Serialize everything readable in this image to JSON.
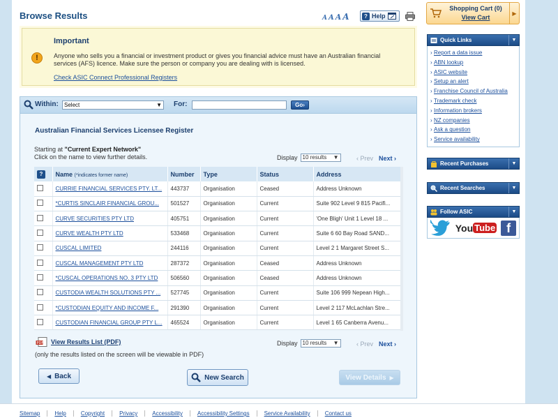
{
  "header": {
    "title": "Browse Results",
    "text_size_letters": [
      "A",
      "A",
      "A",
      "A"
    ],
    "help_label": "Help"
  },
  "important": {
    "heading": "Important",
    "message": "Anyone who sells you a financial or investment product or gives you financial advice must have an Australian financial services (AFS) licence. Make sure the person or company you are dealing with is licensed.",
    "link": "Check ASIC Connect Professional Registers"
  },
  "search": {
    "within_label": "Within:",
    "within_value": "Select",
    "for_label": "For:",
    "for_value": "",
    "go_label": "Go"
  },
  "register": {
    "title": "Australian Financial Services Licensee Register",
    "starting_prefix": "Starting at",
    "starting_value": "\"Current Expert Network\"",
    "instructions": "Click on the name to view further details."
  },
  "pager": {
    "display_label": "Display",
    "display_value": "10 results",
    "prev": "Prev",
    "next": "Next"
  },
  "table": {
    "help_symbol": "?",
    "columns": {
      "name": "Name",
      "name_note": "(*indicates former name)",
      "number": "Number",
      "type": "Type",
      "status": "Status",
      "address": "Address"
    },
    "rows": [
      {
        "name": "CURRIE FINANCIAL SERVICES PTY. LT...",
        "number": "443737",
        "type": "Organisation",
        "status": "Ceased",
        "address": "Address Unknown"
      },
      {
        "name": "*CURTIS SINCLAIR FINANCIAL GROU...",
        "number": "501527",
        "type": "Organisation",
        "status": "Current",
        "address": "Suite 902 Level 9 815 Pacifi..."
      },
      {
        "name": "CURVE SECURITIES PTY LTD",
        "number": "405751",
        "type": "Organisation",
        "status": "Current",
        "address": "'One Bligh' Unit 1 Level 18 ..."
      },
      {
        "name": "CURVE WEALTH PTY LTD",
        "number": "533468",
        "type": "Organisation",
        "status": "Current",
        "address": "Suite 6 60 Bay Road SAND..."
      },
      {
        "name": "CUSCAL LIMITED",
        "number": "244116",
        "type": "Organisation",
        "status": "Current",
        "address": "Level 2 1 Margaret Street S..."
      },
      {
        "name": "CUSCAL MANAGEMENT PTY LTD",
        "number": "287372",
        "type": "Organisation",
        "status": "Ceased",
        "address": "Address Unknown"
      },
      {
        "name": "*CUSCAL OPERATIONS NO. 3 PTY LTD",
        "number": "506560",
        "type": "Organisation",
        "status": "Ceased",
        "address": "Address Unknown"
      },
      {
        "name": "CUSTODIA WEALTH SOLUTIONS PTY ...",
        "number": "527745",
        "type": "Organisation",
        "status": "Current",
        "address": "Suite 106 999 Nepean High..."
      },
      {
        "name": "*CUSTODIAN EQUITY AND INCOME F...",
        "number": "291390",
        "type": "Organisation",
        "status": "Current",
        "address": "Level 2 117 McLachlan Stre..."
      },
      {
        "name": "CUSTODIAN FINANCIAL GROUP PTY L...",
        "number": "465524",
        "type": "Organisation",
        "status": "Current",
        "address": "Level 1 65 Canberra Avenu..."
      }
    ]
  },
  "pdf": {
    "link": "View Results List (PDF)",
    "note": "(only the results listed on the screen will be viewable in PDF)"
  },
  "buttons": {
    "back": "Back",
    "new_search": "New Search",
    "view_details": "View Details"
  },
  "cart": {
    "label": "Shopping Cart (0)",
    "link": "View Cart"
  },
  "sidebar": {
    "quick_links_title": "Quick Links",
    "quick_links": [
      "Report a data issue",
      "ABN lookup",
      "ASIC website",
      "Setup an alert",
      "Franchise Council of Australia",
      "Trademark check",
      "Information brokers",
      "NZ companies",
      "Ask a question",
      "Service availability"
    ],
    "recent_purchases_title": "Recent Purchases",
    "recent_searches_title": "Recent Searches",
    "follow_title": "Follow ASIC",
    "youtube_you": "You",
    "youtube_tube": "Tube",
    "facebook_letter": "f"
  },
  "footer": {
    "links": [
      "Sitemap",
      "Help",
      "Copyright",
      "Privacy",
      "Accessibility",
      "Accessibility Settings",
      "Service Availability",
      "Contact us"
    ]
  }
}
